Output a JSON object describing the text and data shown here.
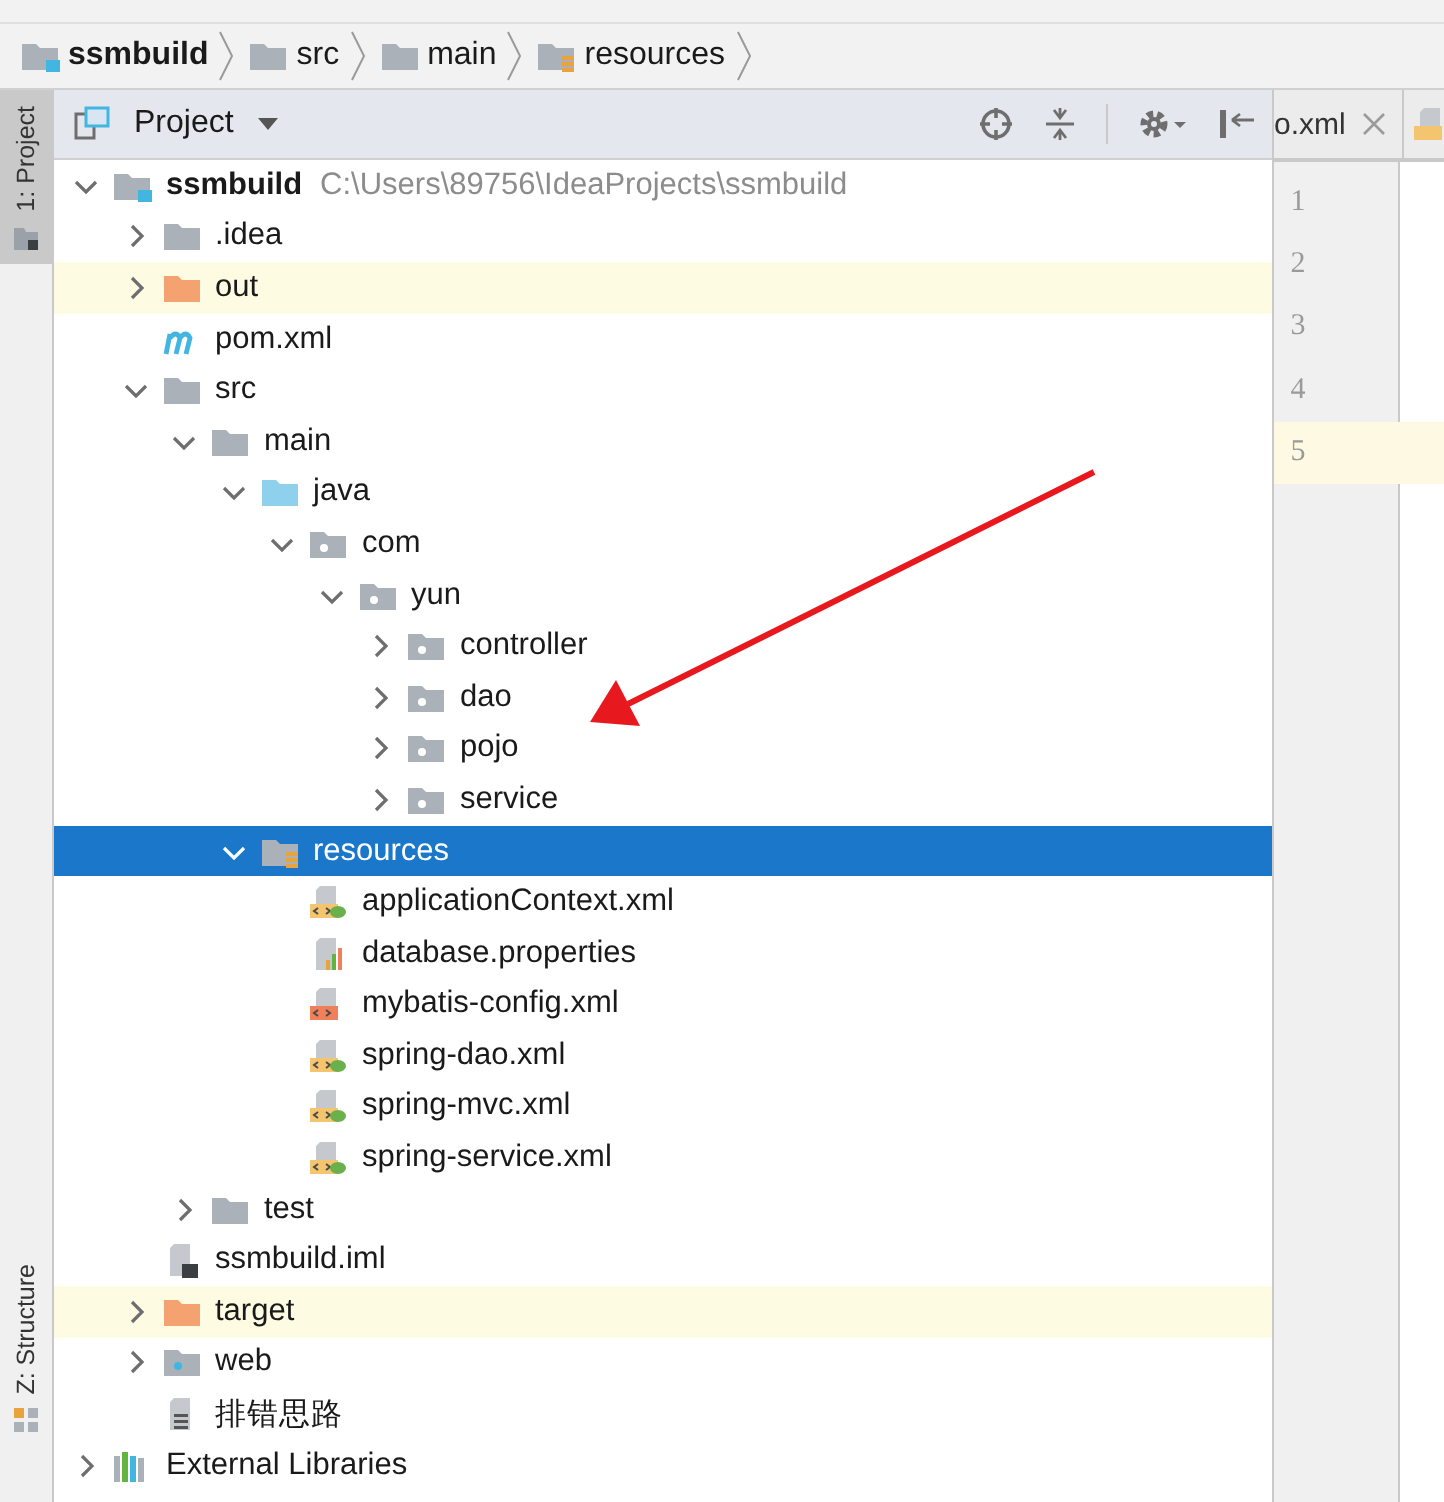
{
  "breadcrumbs": [
    {
      "label": "ssmbuild",
      "kind": "module"
    },
    {
      "label": "src",
      "kind": "folder"
    },
    {
      "label": "main",
      "kind": "folder"
    },
    {
      "label": "resources",
      "kind": "resources"
    }
  ],
  "tool_strip": [
    {
      "label": "1: Project",
      "selected": true
    },
    {
      "label": "Z: Structure",
      "selected": false
    }
  ],
  "panel": {
    "title": "Project"
  },
  "tree": [
    {
      "name": "ssmbuild",
      "path": "C:\\Users\\89756\\IdeaProjects\\ssmbuild",
      "kind": "module",
      "expanded": true,
      "selected": false,
      "children": [
        {
          "name": ".idea",
          "kind": "folder",
          "expanded": false,
          "selected": false
        },
        {
          "name": "out",
          "kind": "excluded",
          "expanded": false,
          "selected": false
        },
        {
          "name": "pom.xml",
          "kind": "maven",
          "selected": false
        },
        {
          "name": "src",
          "kind": "folder",
          "expanded": true,
          "selected": false,
          "children": [
            {
              "name": "main",
              "kind": "folder",
              "expanded": true,
              "selected": false,
              "children": [
                {
                  "name": "java",
                  "kind": "source",
                  "expanded": true,
                  "selected": false,
                  "children": [
                    {
                      "name": "com",
                      "kind": "package",
                      "expanded": true,
                      "selected": false,
                      "children": [
                        {
                          "name": "yun",
                          "kind": "package",
                          "expanded": true,
                          "selected": false,
                          "children": [
                            {
                              "name": "controller",
                              "kind": "package",
                              "expanded": false,
                              "selected": false
                            },
                            {
                              "name": "dao",
                              "kind": "package",
                              "expanded": false,
                              "selected": false
                            },
                            {
                              "name": "pojo",
                              "kind": "package",
                              "expanded": false,
                              "selected": false
                            },
                            {
                              "name": "service",
                              "kind": "package",
                              "expanded": false,
                              "selected": false
                            }
                          ]
                        }
                      ]
                    }
                  ]
                },
                {
                  "name": "resources",
                  "kind": "resources",
                  "expanded": true,
                  "selected": true,
                  "children": [
                    {
                      "name": "applicationContext.xml",
                      "kind": "spring",
                      "selected": false
                    },
                    {
                      "name": "database.properties",
                      "kind": "properties",
                      "selected": false
                    },
                    {
                      "name": "mybatis-config.xml",
                      "kind": "xml",
                      "selected": false
                    },
                    {
                      "name": "spring-dao.xml",
                      "kind": "spring",
                      "selected": false
                    },
                    {
                      "name": "spring-mvc.xml",
                      "kind": "spring",
                      "selected": false
                    },
                    {
                      "name": "spring-service.xml",
                      "kind": "spring",
                      "selected": false
                    }
                  ]
                }
              ]
            },
            {
              "name": "test",
              "kind": "folder",
              "expanded": false,
              "selected": false
            }
          ]
        },
        {
          "name": "ssmbuild.iml",
          "kind": "iml",
          "selected": false
        },
        {
          "name": "target",
          "kind": "excluded",
          "expanded": false,
          "selected": false
        },
        {
          "name": "web",
          "kind": "web",
          "expanded": false,
          "selected": false
        },
        {
          "name": "排错思路",
          "kind": "text",
          "selected": false
        }
      ]
    },
    {
      "name": "External Libraries",
      "kind": "libraries",
      "expanded": false,
      "selected": false
    }
  ],
  "editor": {
    "tabs": [
      {
        "label": "o.xml"
      }
    ],
    "lines": [
      {
        "number": "1",
        "current": false
      },
      {
        "number": "2",
        "current": false
      },
      {
        "number": "3",
        "current": false
      },
      {
        "number": "4",
        "current": false
      },
      {
        "number": "5",
        "current": true
      }
    ]
  }
}
